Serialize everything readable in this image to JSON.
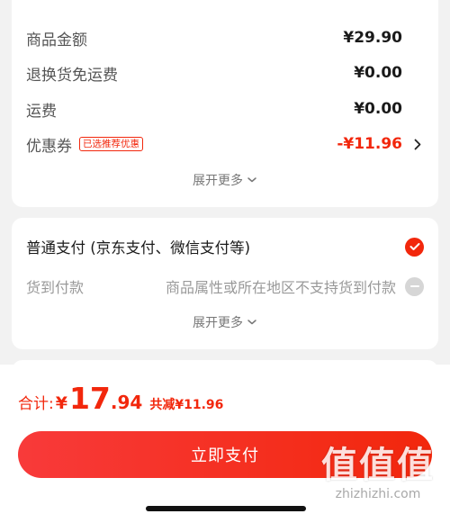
{
  "price_card": {
    "rows": [
      {
        "label": "商品金额",
        "value": "¥29.90"
      },
      {
        "label": "退换货免运费",
        "value": "¥0.00"
      },
      {
        "label": "运费",
        "value": "¥0.00"
      }
    ],
    "coupon": {
      "label": "优惠券",
      "tag": "已选推荐优惠",
      "value": "-¥11.96"
    },
    "expand_label": "展开更多"
  },
  "payment_card": {
    "options": [
      {
        "label": "普通支付 (京东支付、微信支付等)",
        "selected": true
      },
      {
        "label": "货到付款",
        "note": "商品属性或所在地区不支持货到付款",
        "selected": false
      }
    ],
    "expand_label": "展开更多"
  },
  "bottom_bar": {
    "total_label": "合计:",
    "currency": "¥",
    "total_int": "17",
    "total_dec": ".94",
    "saved": "共减¥11.96",
    "pay_button": "立即支付"
  },
  "watermark": {
    "chars": "值值值",
    "url": "zhizhizhi.com"
  },
  "colors": {
    "accent": "#f2270c",
    "background": "#f2f2f2",
    "card": "#ffffff"
  },
  "icons": [
    "chevron-right-icon",
    "chevron-down-icon",
    "check-icon",
    "minus-icon"
  ]
}
